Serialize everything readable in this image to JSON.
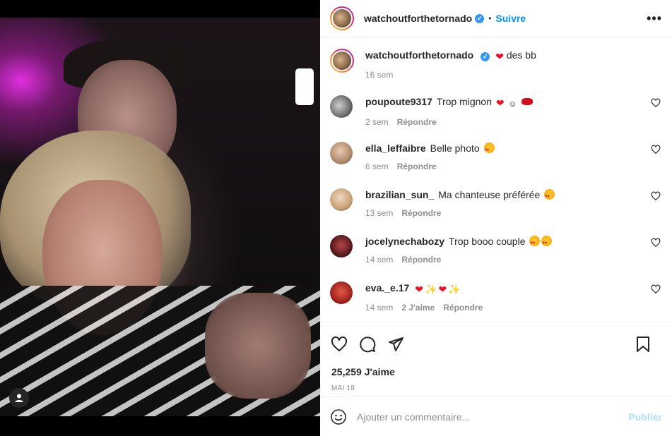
{
  "post": {
    "author": "watchoutforthetornado",
    "follow_label": "Suivre",
    "dot": "•",
    "more": "•••"
  },
  "caption": {
    "username": "watchoutforthetornado",
    "text": "des bb",
    "time": "16 sem"
  },
  "comments": [
    {
      "username": "poupoute9317",
      "text": "Trop mignon",
      "time": "2 sem",
      "reply": "Répondre",
      "likes": ""
    },
    {
      "username": "ella_leffaibre",
      "text": "Belle photo",
      "time": "6 sem",
      "reply": "Répondre",
      "likes": ""
    },
    {
      "username": "brazilian_sun_",
      "text": "Ma chanteuse préférée",
      "time": "13 sem",
      "reply": "Répondre",
      "likes": ""
    },
    {
      "username": "jocelynechabozy",
      "text": "Trop booo couple",
      "time": "14 sem",
      "reply": "Répondre",
      "likes": ""
    },
    {
      "username": "eva._e.17",
      "text": "",
      "time": "14 sem",
      "reply": "Répondre",
      "likes": "2 J'aime"
    }
  ],
  "stats": {
    "likes": "25,259 J'aime",
    "date": "MAI 18"
  },
  "add_comment": {
    "placeholder": "Ajouter un commentaire...",
    "publish": "Publier"
  },
  "colors": {
    "accent": "#0095f6",
    "verified": "#3897f0",
    "publish_disabled": "#b2dffc",
    "muted": "#8e8e8e"
  },
  "icons": [
    "user-tag-icon",
    "verified-icon",
    "more-icon",
    "heart-icon",
    "comment-icon",
    "share-icon",
    "bookmark-icon",
    "emoji-icon"
  ]
}
